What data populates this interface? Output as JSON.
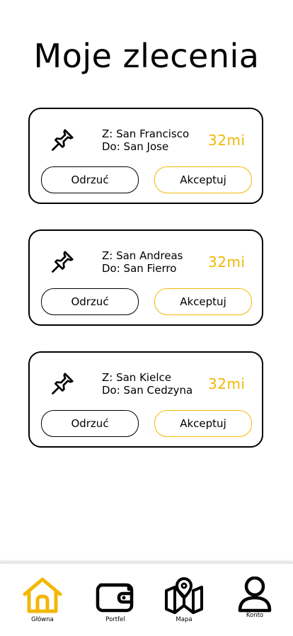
{
  "header": {
    "title": "Moje zlecenia"
  },
  "orders": [
    {
      "from": "Z: San Francisco",
      "to": "Do: San Jose",
      "distance": "32mi",
      "reject_label": "Odrzuć",
      "accept_label": "Akceptuj"
    },
    {
      "from": "Z: San Andreas",
      "to": "Do: San Fierro",
      "distance": "32mi",
      "reject_label": "Odrzuć",
      "accept_label": "Akceptuj"
    },
    {
      "from": "Z: San Kielce",
      "to": "Do: San Cedzyna",
      "distance": "32mi",
      "reject_label": "Odrzuć",
      "accept_label": "Akceptuj"
    }
  ],
  "nav": {
    "items": [
      {
        "label": "Główna",
        "icon": "home-icon",
        "active": true
      },
      {
        "label": "Portfel",
        "icon": "wallet-icon",
        "active": false
      },
      {
        "label": "Mapa",
        "icon": "map-icon",
        "active": false
      },
      {
        "label": "Konto",
        "icon": "user-icon",
        "active": false
      }
    ]
  },
  "colors": {
    "accent": "#f2b705",
    "text": "#000000",
    "background": "#ffffff"
  }
}
